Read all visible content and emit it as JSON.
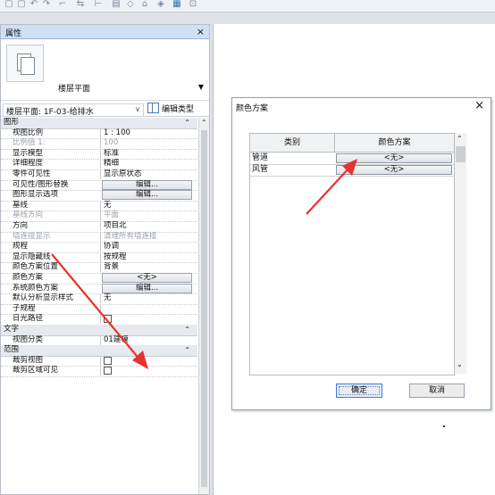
{
  "colors": {
    "annotation_arrow": "#e8322d",
    "accent": "#3d7bd4"
  },
  "toolbar": {
    "icons": [
      "save-icon",
      "open-icon",
      "undo-icon",
      "redo-icon",
      "print-icon",
      "measure-icon",
      "dimension-icon",
      "text-icon",
      "tag-icon",
      "3d-view-icon",
      "section-icon",
      "thin-lines-icon",
      "close-hidden-icon"
    ]
  },
  "properties": {
    "title": "属性",
    "close": "×",
    "type_name": "楼层平面",
    "view_selector": "楼层平面: 1F-03-给排水",
    "edit_type": "编辑类型",
    "sections": {
      "graphics": "图形",
      "text": "文字",
      "extents": "范围"
    },
    "rows": [
      {
        "label": "视图比例",
        "value": "1 : 100"
      },
      {
        "label": "比例值 1:",
        "value": "100"
      },
      {
        "label": "显示模型",
        "value": "标准"
      },
      {
        "label": "详细程度",
        "value": "精细"
      },
      {
        "label": "零件可见性",
        "value": "显示原状态"
      },
      {
        "label": "可见性/图形替换",
        "value": "编辑..."
      },
      {
        "label": "图形显示选项",
        "value": "编辑..."
      },
      {
        "label": "基线",
        "value": "无"
      },
      {
        "label": "基线方向",
        "value": "平面"
      },
      {
        "label": "方向",
        "value": "项目北"
      },
      {
        "label": "墙连接显示",
        "value": "清理所有墙连接"
      },
      {
        "label": "规程",
        "value": "协调"
      },
      {
        "label": "显示隐藏线",
        "value": "按规程"
      },
      {
        "label": "颜色方案位置",
        "value": "背景"
      },
      {
        "label": "颜色方案",
        "value": "<无>"
      },
      {
        "label": "系统颜色方案",
        "value": "编辑..."
      },
      {
        "label": "默认分析显示样式",
        "value": "无"
      },
      {
        "label": "子规程",
        "value": ""
      },
      {
        "label": "日光路径",
        "value": ""
      }
    ],
    "text_rows": [
      {
        "label": "视图分类",
        "value": "01建模"
      }
    ],
    "extent_rows": [
      {
        "label": "裁剪视图",
        "value": ""
      },
      {
        "label": "裁剪区域可见",
        "value": ""
      }
    ]
  },
  "dialog": {
    "title": "颜色方案",
    "close": "×",
    "columns": [
      "类别",
      "颜色方案"
    ],
    "rows": [
      {
        "category": "管道",
        "scheme": "<无>"
      },
      {
        "category": "风管",
        "scheme": "<无>"
      }
    ],
    "ok": "确定",
    "cancel": "取消"
  }
}
